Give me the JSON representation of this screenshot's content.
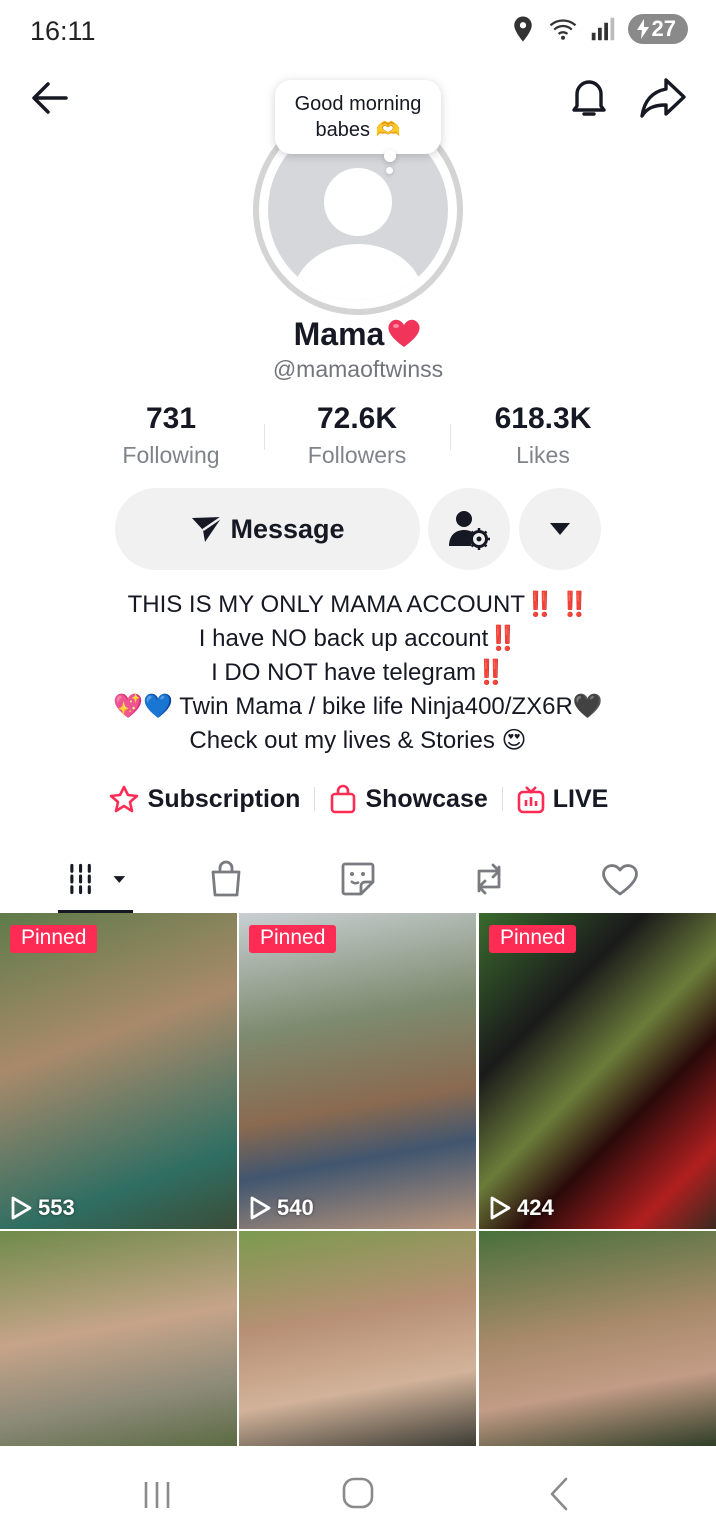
{
  "status_bar": {
    "time": "16:11",
    "battery": "27"
  },
  "profile": {
    "bubble_text_line1": "Good morning",
    "bubble_text_line2": "babes 🫶",
    "name": "Mama",
    "handle": "@mamaoftwinss"
  },
  "stats": [
    {
      "value": "731",
      "label": "Following"
    },
    {
      "value": "72.6K",
      "label": "Followers"
    },
    {
      "value": "618.3K",
      "label": "Likes"
    }
  ],
  "actions": {
    "message_label": "Message"
  },
  "bio": {
    "line1": "THIS IS MY ONLY MAMA ACCOUNT",
    "line1_marks": "‼️ ‼️",
    "line2": "I have NO back up account",
    "line2_marks": "‼️",
    "line3": "I DO NOT have telegram",
    "line3_marks": "‼️",
    "line4_prefix": "💖💙",
    "line4": " Twin Mama / bike life Ninja400/ZX6R",
    "line4_suffix": "🖤",
    "line5": "Check out my lives & Stories ",
    "line5_suffix": "😍"
  },
  "links": [
    {
      "label": "Subscription",
      "icon": "star-badge-icon"
    },
    {
      "label": "Showcase",
      "icon": "shopping-bag-icon"
    },
    {
      "label": "LIVE",
      "icon": "tv-live-icon"
    }
  ],
  "tabs": [
    "videos-grid-icon",
    "shop-bag-icon",
    "sticker-icon",
    "repost-icon",
    "liked-heart-icon"
  ],
  "videos": [
    {
      "pinned": "Pinned",
      "views": "553"
    },
    {
      "pinned": "Pinned",
      "views": "540"
    },
    {
      "pinned": "Pinned",
      "views": "424"
    },
    {
      "pinned": "",
      "views": ""
    },
    {
      "pinned": "",
      "views": ""
    },
    {
      "pinned": "",
      "views": ""
    }
  ],
  "colors": {
    "accent": "#fe2c55",
    "text": "#161823",
    "secondary": "#80838a",
    "button_bg": "#f1f1f2"
  }
}
